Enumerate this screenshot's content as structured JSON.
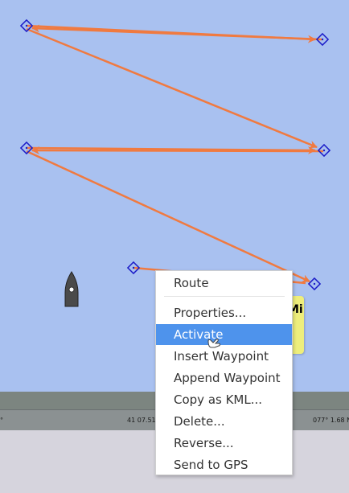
{
  "route_popup": {
    "line1": "Mi",
    "line2": "-"
  },
  "status_bar": {
    "cell1": "°",
    "cell2": "41 07.51",
    "cell3": "077° 1.68 N"
  },
  "context_menu": {
    "title": "Route",
    "items": [
      {
        "label": "Properties..."
      },
      {
        "label": "Activate"
      },
      {
        "label": "Insert Waypoint"
      },
      {
        "label": "Append Waypoint"
      },
      {
        "label": "Copy as KML..."
      },
      {
        "label": "Delete..."
      },
      {
        "label": "Reverse..."
      },
      {
        "label": "Send to GPS"
      }
    ],
    "highlighted_item": "Activate"
  },
  "colors": {
    "water": "#a9c1f0",
    "route_line": "#f07a40",
    "waypoint": "#1a1ac8",
    "menu_highlight": "#4e93ec",
    "popup_label": "#eeee7c"
  },
  "icons": {
    "waypoint": "diamond-waypoint-icon",
    "boat": "ownship-boat-icon",
    "cursor": "hand-pointer-icon"
  }
}
